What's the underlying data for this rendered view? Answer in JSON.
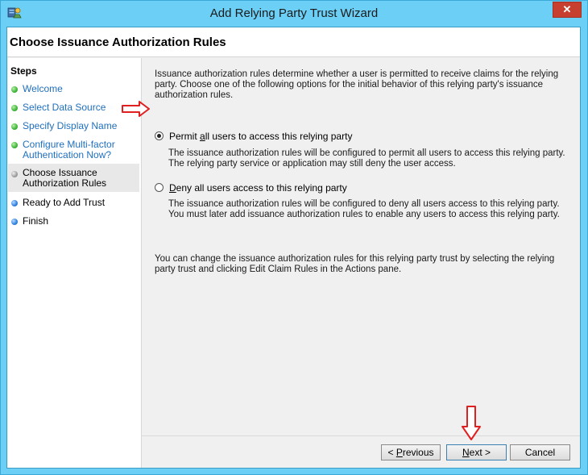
{
  "window": {
    "title": "Add Relying Party Trust Wizard",
    "close_glyph": "✕"
  },
  "page": {
    "title": "Choose Issuance Authorization Rules"
  },
  "steps": {
    "title": "Steps",
    "items": [
      {
        "label": "Welcome",
        "status": "green"
      },
      {
        "label": "Select Data Source",
        "status": "green"
      },
      {
        "label": "Specify Display Name",
        "status": "green"
      },
      {
        "label": "Configure Multi-factor Authentication Now?",
        "status": "green"
      },
      {
        "label": "Choose Issuance Authorization Rules",
        "status": "green"
      },
      {
        "label": "Ready to Add Trust",
        "status": "blue"
      },
      {
        "label": "Finish",
        "status": "blue"
      }
    ]
  },
  "content": {
    "intro": "Issuance authorization rules determine whether a user is permitted to receive claims for the relying party. Choose one of the following options for the initial behavior of this relying party's issuance authorization rules.",
    "option_permit": {
      "prefix": "Permit ",
      "accel": "a",
      "suffix": "ll users to access this relying party",
      "description": "The issuance authorization rules will be configured to permit all users to access this relying party. The relying party service or application may still deny the user access.",
      "checked": true
    },
    "option_deny": {
      "prefix": "",
      "accel": "D",
      "suffix": "eny all users access to this relying party",
      "description": "The issuance authorization rules will be configured to deny all users access to this relying party. You must later add issuance authorization rules to enable any users to access this relying party.",
      "checked": false
    },
    "footer_note": "You can change the issuance authorization rules for this relying party trust by selecting the relying party trust and clicking Edit Claim Rules in the Actions pane."
  },
  "buttons": {
    "previous": {
      "prefix": "< ",
      "accel": "P",
      "suffix": "revious"
    },
    "next": {
      "accel": "N",
      "suffix": "ext >"
    },
    "cancel": "Cancel"
  },
  "colors": {
    "annotation_arrow": "#e02020",
    "link": "#1f6fbf"
  }
}
